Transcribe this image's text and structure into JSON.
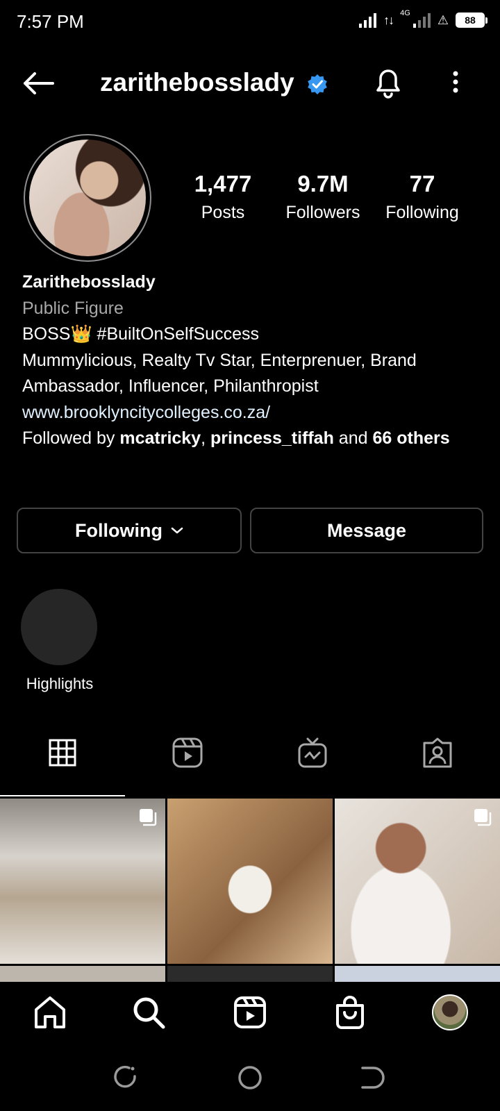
{
  "status_bar": {
    "time": "7:57 PM",
    "network_label": "4G",
    "battery": "88",
    "arrows": "↑↓"
  },
  "header": {
    "username": "zarithebosslady",
    "verified": true
  },
  "profile": {
    "stats": [
      {
        "value": "1,477",
        "label": "Posts"
      },
      {
        "value": "9.7M",
        "label": "Followers"
      },
      {
        "value": "77",
        "label": "Following"
      }
    ],
    "name": "Zarithebosslady",
    "category": "Public Figure",
    "bio_line1": "BOSS👑 #BuiltOnSelfSuccess",
    "bio_line2": "Mummylicious, Realty Tv Star, Enterprenuer, Brand Ambassador, Influencer, Philanthropist",
    "link": "www.brooklyncitycolleges.co.za/",
    "followed_by_prefix": "Followed by ",
    "followed_by_user1": "mcatricky",
    "followed_by_sep": ", ",
    "followed_by_user2": "princess_tiffah",
    "followed_by_and": " and ",
    "followed_by_others": "66 others"
  },
  "actions": {
    "following_label": "Following",
    "message_label": "Message"
  },
  "highlights": {
    "label": "Highlights"
  },
  "tabs": [
    "grid-icon",
    "reels-icon",
    "igtv-icon",
    "tagged-icon"
  ],
  "colors": {
    "background": "#000000",
    "verified": "#3897f0",
    "button_border": "#444444",
    "secondary_text": "#a8a8a8"
  }
}
